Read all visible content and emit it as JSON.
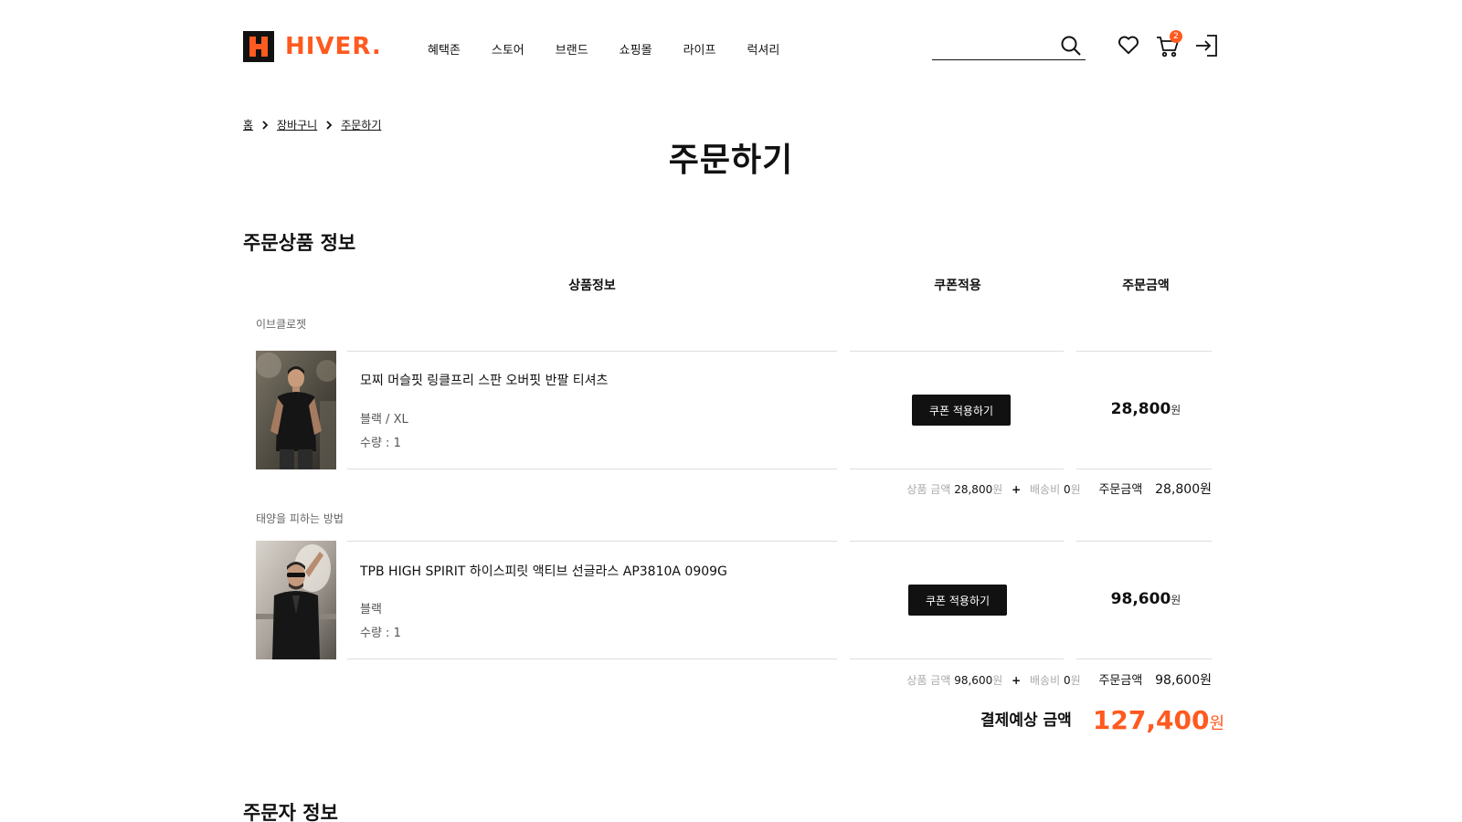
{
  "brand": {
    "name": "HIVER.",
    "accent": "#ff5a1f"
  },
  "nav": [
    "혜택존",
    "스토어",
    "브랜드",
    "쇼핑몰",
    "라이프",
    "럭셔리"
  ],
  "search": {
    "placeholder": ""
  },
  "cart": {
    "count": "2"
  },
  "icons": [
    "search-icon",
    "heart-icon",
    "cart-icon",
    "login-icon",
    "chevron-right-icon"
  ],
  "breadcrumb": [
    "홈",
    "장바구니",
    "주문하기"
  ],
  "page_title": "주문하기",
  "order_section": {
    "title": "주문상품 정보",
    "columns": [
      "상품정보",
      "쿠폰적용",
      "주문금액"
    ]
  },
  "items": [
    {
      "shop": "이브클로젯",
      "name": "모찌 머슬핏 링클프리 스판 오버핏 반팔 티셔츠",
      "option": "블랙 / XL",
      "quantity": "수량 : 1",
      "coupon_label": "쿠폰 적용하기",
      "price": "28,800",
      "price_unit": "원",
      "summary": {
        "product_label": "상품 금액",
        "product_amount": "28,800",
        "unit": "원",
        "shipping_label": "배송비",
        "shipping_amount": "0",
        "order_label": "주문금액",
        "order_amount": "28,800원"
      }
    },
    {
      "shop": "태양을 피하는 방법",
      "name": "TPB HIGH SPIRIT 하이스피릿 액티브 선글라스 AP3810A 0909G",
      "option": "블랙",
      "quantity": "수량 : 1",
      "coupon_label": "쿠폰 적용하기",
      "price": "98,600",
      "price_unit": "원",
      "summary": {
        "product_label": "상품 금액",
        "product_amount": "98,600",
        "unit": "원",
        "shipping_label": "배송비",
        "shipping_amount": "0",
        "order_label": "주문금액",
        "order_amount": "98,600원"
      }
    }
  ],
  "total": {
    "label": "결제예상 금액",
    "amount": "127,400",
    "unit": "원"
  },
  "orderer_section": {
    "title": "주문자 정보"
  }
}
